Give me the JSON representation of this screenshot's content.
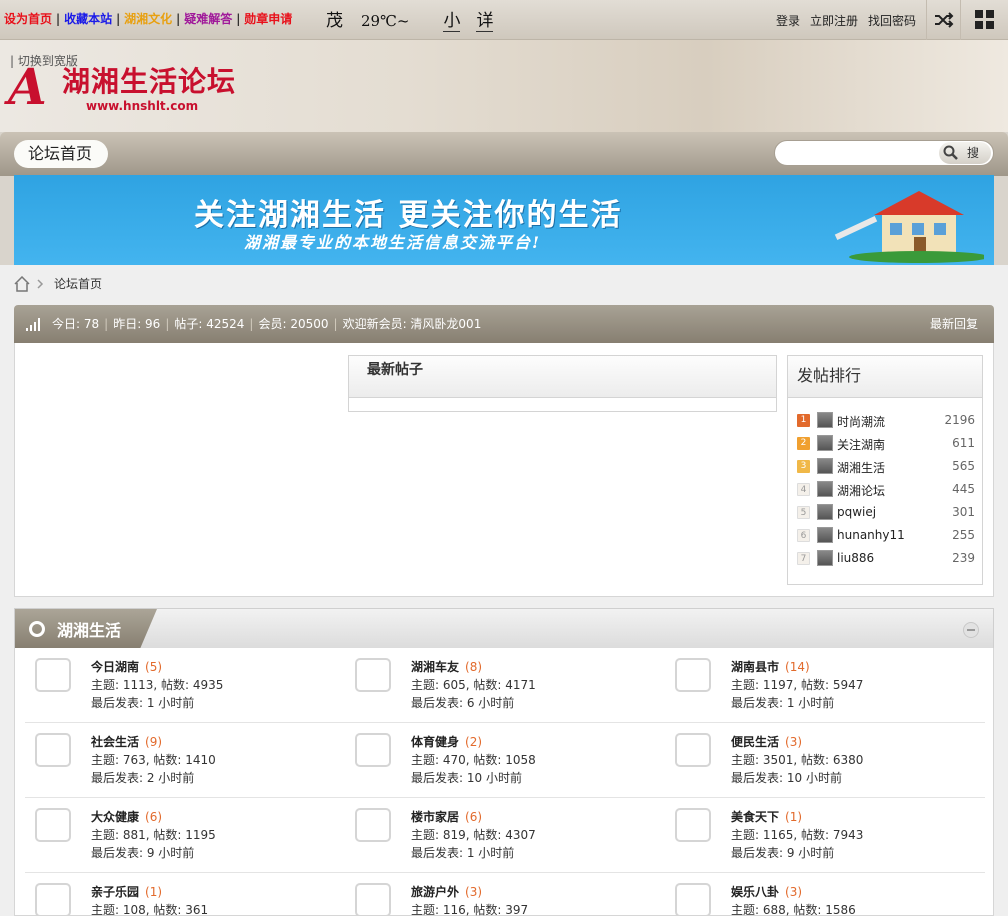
{
  "topbar": {
    "links": [
      {
        "label": "设为首页",
        "color": "#e8101a"
      },
      {
        "label": "收藏本站",
        "color": "#1a1ae8"
      },
      {
        "label": "湖湘文化",
        "color": "#e8a010"
      },
      {
        "label": "疑难解答",
        "color": "#a01a9a"
      },
      {
        "label": "勋章申请",
        "color": "#e8101a"
      }
    ],
    "separator": "|",
    "weather": {
      "glyph": "茂",
      "temp": "29℃~",
      "small": "小",
      "detail": "详"
    },
    "user_links": [
      "登录",
      "立即注册",
      "找回密码"
    ],
    "shuffle_icon": "shuffle-icon",
    "grid_icon": "grid-icon"
  },
  "header": {
    "switch_link": "切换到宽版",
    "logo_letter": "A",
    "logo_name": "湖湘生活论坛",
    "logo_url": "www.hnshlt.com"
  },
  "nav": {
    "home": "论坛首页",
    "search_placeholder": "",
    "search_button": "搜",
    "search_icon": "magnifier-icon"
  },
  "banner": {
    "headline": "关注湖湘生活  更关注你的生活",
    "subline": "湖湘最专业的本地生活信息交流平台!"
  },
  "breadcrumb": {
    "home_icon": "home-icon",
    "current": "论坛首页"
  },
  "stats": {
    "items": [
      "今日: 78",
      "昨日: 96",
      "帖子: 42524",
      "会员: 20500",
      "欢迎新会员: 清风卧龙001"
    ],
    "latest_reply": "最新回复"
  },
  "new_posts": {
    "title": "最新帖子"
  },
  "ranking": {
    "title": "发帖排行",
    "badge_colors": [
      "#e26a2c",
      "#f0a030",
      "#f0b848"
    ],
    "rows": [
      {
        "rank": "1",
        "name": "时尚潮流",
        "count": "2196"
      },
      {
        "rank": "2",
        "name": "关注湖南",
        "count": "611"
      },
      {
        "rank": "3",
        "name": "湖湘生活",
        "count": "565"
      },
      {
        "rank": "4",
        "name": "湖湘论坛",
        "count": "445"
      },
      {
        "rank": "5",
        "name": "pqwiej",
        "count": "301"
      },
      {
        "rank": "6",
        "name": "hunanhy11",
        "count": "255"
      },
      {
        "rank": "7",
        "name": "liu886",
        "count": "239"
      }
    ]
  },
  "category": {
    "title": "湖湘生活",
    "rows": [
      [
        {
          "name": "今日湖南",
          "count": "(5)",
          "stats": "主题: 1113, 帖数: 4935",
          "last": "最后发表: 1 小时前"
        },
        {
          "name": "湖湘车友",
          "count": "(8)",
          "stats": "主题: 605, 帖数: 4171",
          "last": "最后发表: 6 小时前"
        },
        {
          "name": "湖南县市",
          "count": "(14)",
          "stats": "主题: 1197, 帖数: 5947",
          "last": "最后发表: 1 小时前"
        }
      ],
      [
        {
          "name": "社会生活",
          "count": "(9)",
          "stats": "主题: 763, 帖数: 1410",
          "last": "最后发表: 2 小时前"
        },
        {
          "name": "体育健身",
          "count": "(2)",
          "stats": "主题: 470, 帖数: 1058",
          "last": "最后发表: 10 小时前"
        },
        {
          "name": "便民生活",
          "count": "(3)",
          "stats": "主题: 3501, 帖数: 6380",
          "last": "最后发表: 10 小时前"
        }
      ],
      [
        {
          "name": "大众健康",
          "count": "(6)",
          "stats": "主题: 881, 帖数: 1195",
          "last": "最后发表: 9 小时前"
        },
        {
          "name": "楼市家居",
          "count": "(6)",
          "stats": "主题: 819, 帖数: 4307",
          "last": "最后发表: 1 小时前"
        },
        {
          "name": "美食天下",
          "count": "(1)",
          "stats": "主题: 1165, 帖数: 7943",
          "last": "最后发表: 9 小时前"
        }
      ],
      [
        {
          "name": "亲子乐园",
          "count": "(1)",
          "stats": "主题: 108, 帖数: 361",
          "last": ""
        },
        {
          "name": "旅游户外",
          "count": "(3)",
          "stats": "主题: 116, 帖数: 397",
          "last": ""
        },
        {
          "name": "娱乐八卦",
          "count": "(3)",
          "stats": "主题: 688, 帖数: 1586",
          "last": ""
        }
      ]
    ]
  }
}
